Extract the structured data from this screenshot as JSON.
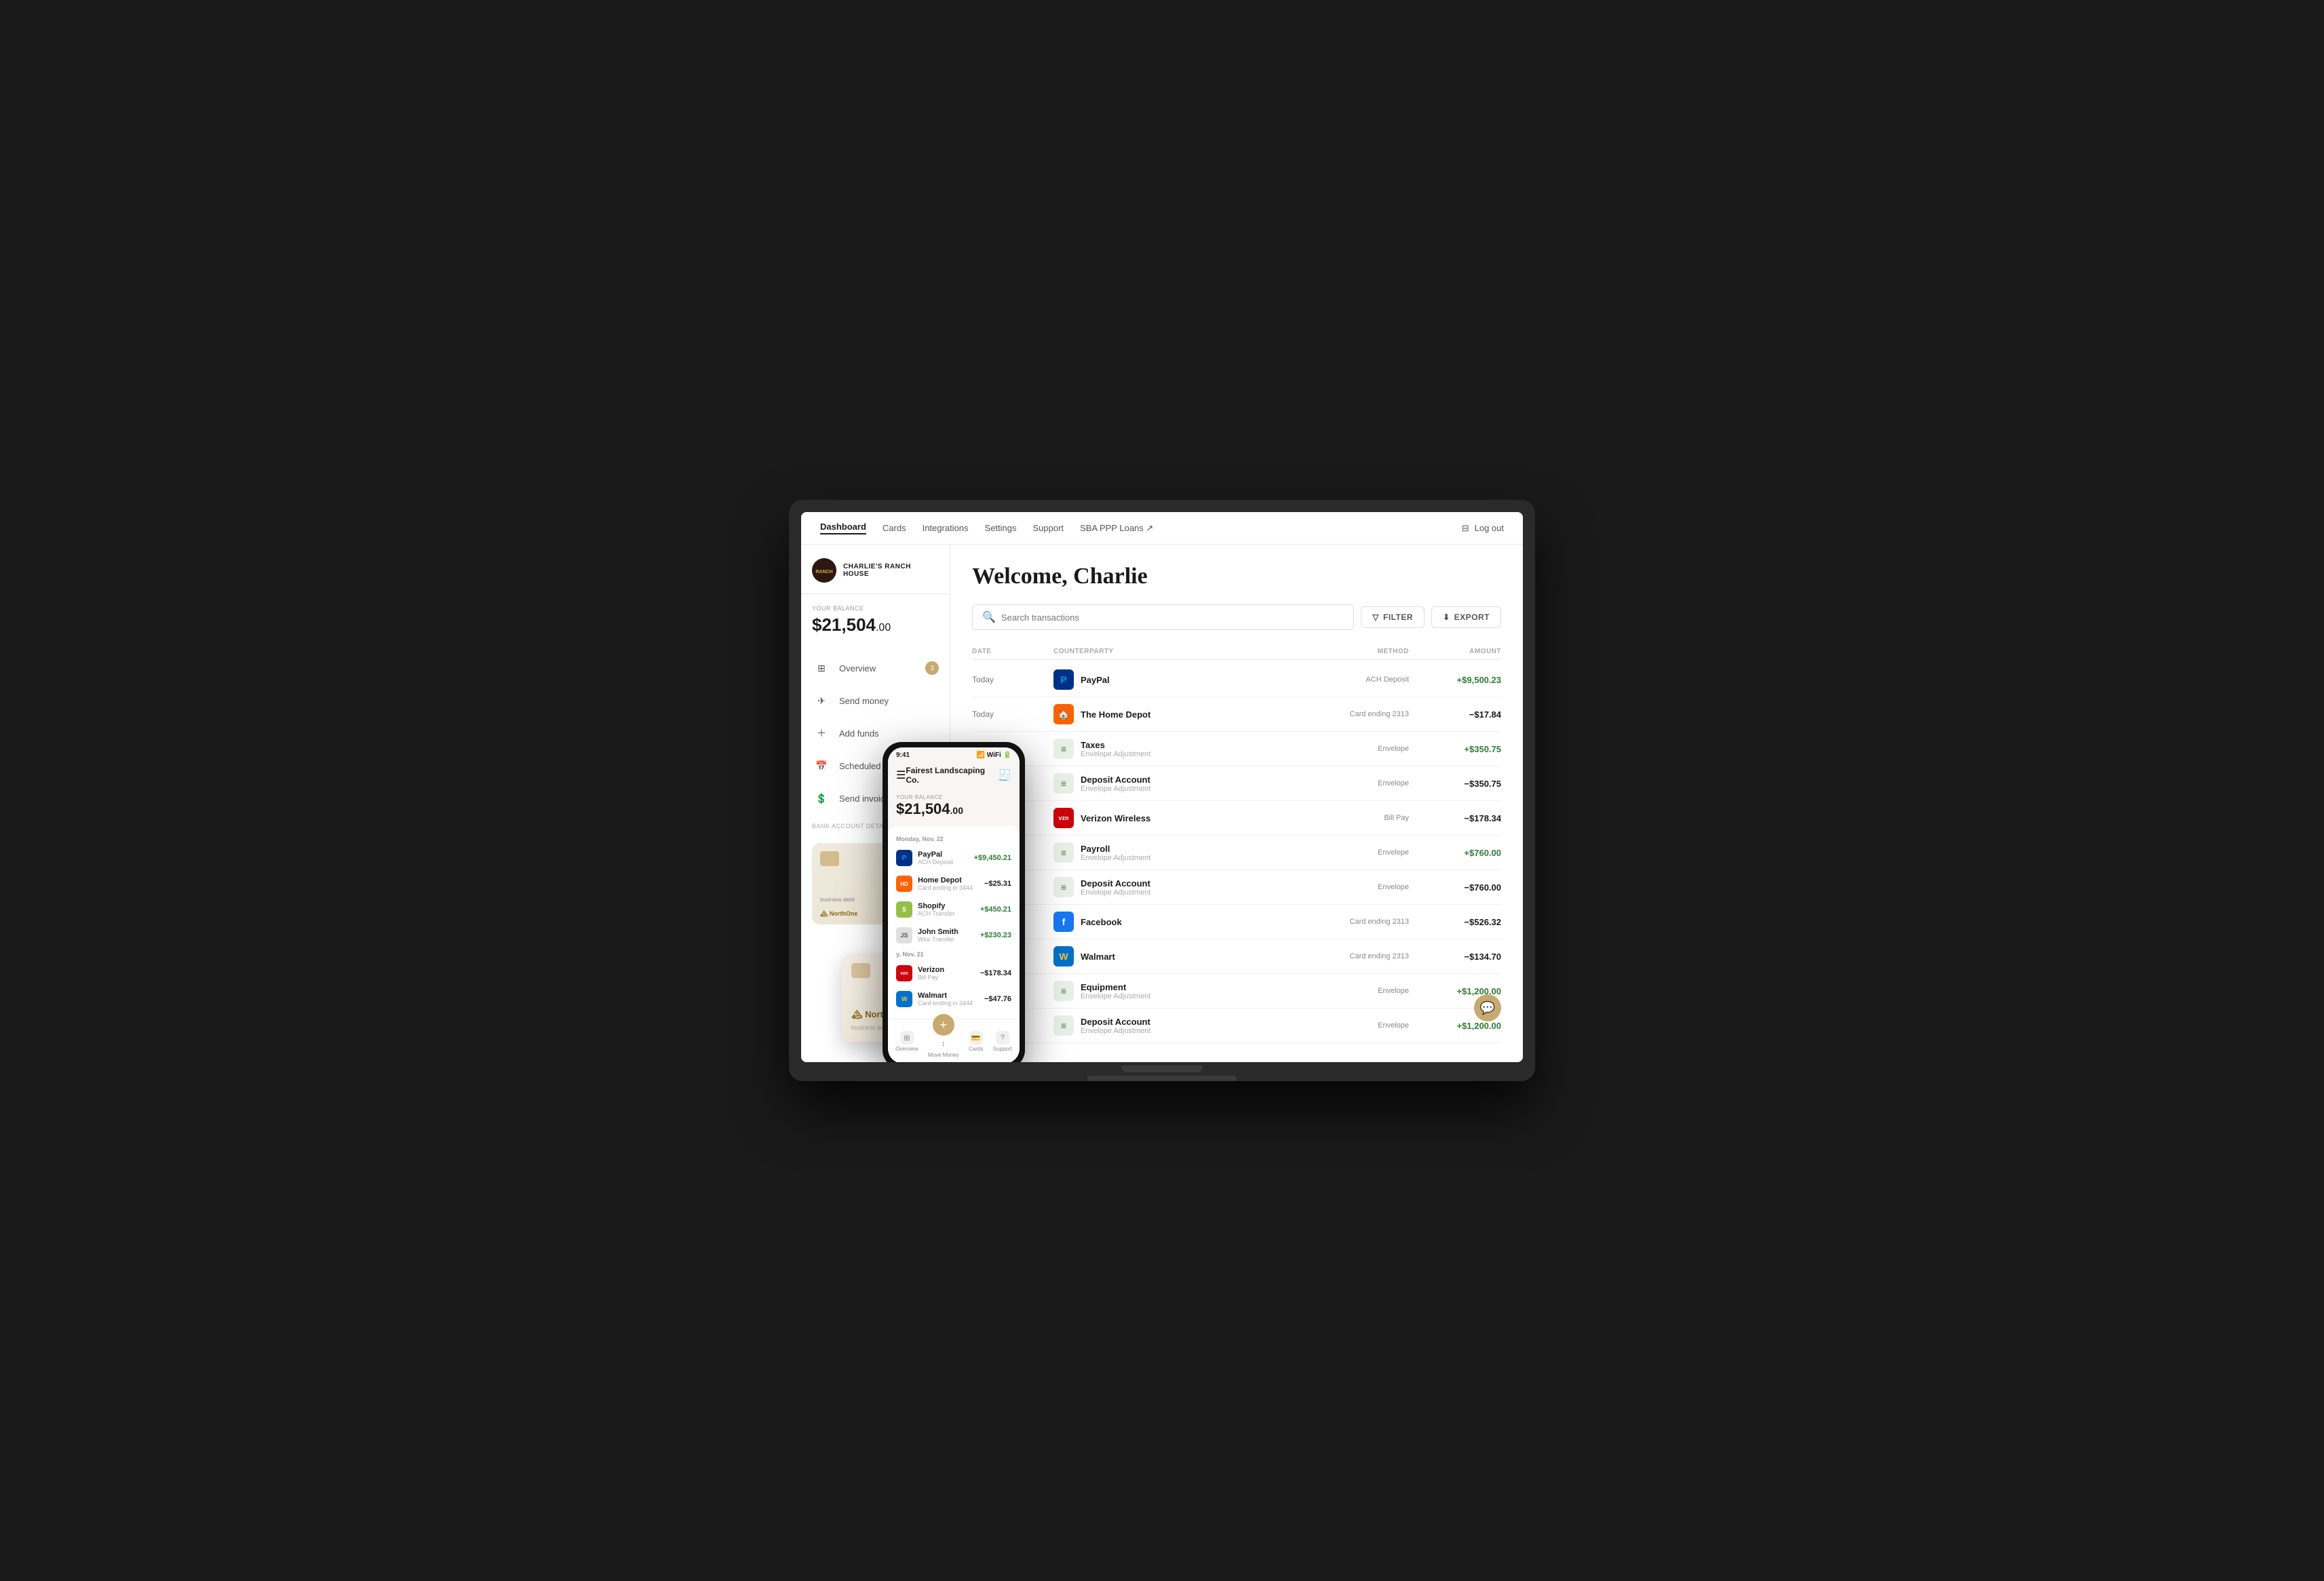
{
  "nav": {
    "links": [
      "Dashboard",
      "Cards",
      "Integrations",
      "Settings",
      "Support",
      "SBA PPP Loans ↗"
    ],
    "active": "Dashboard",
    "logout": "Log out"
  },
  "sidebar": {
    "company": "Charlie's Ranch House",
    "balance_label": "YOUR BALANCE",
    "balance_dollars": "$21,504",
    "balance_cents": ".00",
    "nav_items": [
      {
        "id": "overview",
        "label": "Overview",
        "badge": "3",
        "icon": "⊞"
      },
      {
        "id": "send-money",
        "label": "Send money",
        "icon": "✈"
      },
      {
        "id": "add-funds",
        "label": "Add funds",
        "icon": "+"
      },
      {
        "id": "scheduled-payments",
        "label": "Scheduled payments",
        "icon": "📅"
      },
      {
        "id": "send-invoice",
        "label": "Send invoice",
        "icon": "💲"
      }
    ],
    "bank_account_label": "BANK ACCOUNT DETAILS"
  },
  "content": {
    "welcome": "Welcome, Charlie",
    "search_placeholder": "Search transactions",
    "filter_label": "FILTER",
    "export_label": "EXPORT",
    "table_headers": [
      "DATE",
      "COUNTERPARTY",
      "METHOD",
      "AMOUNT"
    ],
    "transactions": [
      {
        "date": "Today",
        "name": "PayPal",
        "sub": "",
        "method": "ACH Deposit",
        "amount": "+$9,500.23",
        "positive": true,
        "logo_type": "paypal"
      },
      {
        "date": "Today",
        "name": "The Home Depot",
        "sub": "",
        "method": "Card ending 2313",
        "amount": "−$17.84",
        "positive": false,
        "logo_type": "homedepot"
      },
      {
        "date": "",
        "name": "Taxes",
        "sub": "Envelope Adjustment",
        "method": "Envelope",
        "amount": "+$350.75",
        "positive": true,
        "logo_type": "envelope"
      },
      {
        "date": "",
        "name": "Deposit Account",
        "sub": "Envelope Adjustment",
        "method": "Envelope",
        "amount": "−$350.75",
        "positive": false,
        "logo_type": "envelope"
      },
      {
        "date": "",
        "name": "Verizon Wireless",
        "sub": "",
        "method": "Bill Pay",
        "amount": "−$178.34",
        "positive": false,
        "logo_type": "verizon"
      },
      {
        "date": "",
        "name": "Payroll",
        "sub": "Envelope Adjustment",
        "method": "Envelope",
        "amount": "+$760.00",
        "positive": true,
        "logo_type": "envelope"
      },
      {
        "date": "",
        "name": "Deposit Account",
        "sub": "Envelope Adjustment",
        "method": "Envelope",
        "amount": "−$760.00",
        "positive": false,
        "logo_type": "envelope"
      },
      {
        "date": "",
        "name": "Facebook",
        "sub": "",
        "method": "Card ending 2313",
        "amount": "−$526.32",
        "positive": false,
        "logo_type": "facebook"
      },
      {
        "date": "",
        "name": "Walmart",
        "sub": "",
        "method": "Card ending 2313",
        "amount": "−$134.70",
        "positive": false,
        "logo_type": "walmart"
      },
      {
        "date": "",
        "name": "Equipment",
        "sub": "Envelope Adjustment",
        "method": "Envelope",
        "amount": "+$1,200.00",
        "positive": true,
        "logo_type": "envelope"
      },
      {
        "date": "",
        "name": "Deposit Account",
        "sub": "Envelope Adjustment",
        "method": "Envelope",
        "amount": "+$1,200.00",
        "positive": true,
        "logo_type": "envelope"
      }
    ]
  },
  "phone": {
    "time": "9:41",
    "company": "Fairest Landscaping Co.",
    "balance_label": "YOUR BALANCE",
    "balance": "$21,504",
    "balance_cents": ".00",
    "date_label": "Monday, Nov. 22",
    "transactions": [
      {
        "name": "PayPal",
        "sub": "ACH Deposit",
        "amount": "+$9,450.21",
        "pos": true,
        "logo": "paypal"
      },
      {
        "name": "Home Depot",
        "sub": "Card ending in 3444",
        "amount": "−$25.31",
        "pos": false,
        "logo": "homedepot"
      },
      {
        "name": "Shopify",
        "sub": "ACH Transfer",
        "amount": "+$450.21",
        "pos": true,
        "logo": "shopify"
      },
      {
        "name": "John Smith",
        "sub": "Wire Transfer",
        "amount": "+$230.23",
        "pos": true,
        "logo": "person"
      },
      {
        "name": "Verizon",
        "sub": "Bill Pay",
        "amount": "−$178.34",
        "pos": false,
        "logo": "verizon"
      },
      {
        "name": "Walmart",
        "sub": "Card ending in 3444",
        "amount": "−$47.76",
        "pos": false,
        "logo": "walmart"
      }
    ],
    "date_label2": "y, Nov. 21",
    "nav": [
      {
        "label": "Overview",
        "icon": "⊞"
      },
      {
        "label": "Move Money",
        "icon": "↕"
      },
      {
        "label": "Cards",
        "icon": "💳"
      },
      {
        "label": "Support",
        "icon": "?"
      }
    ]
  },
  "card": {
    "brand": "NorthOne",
    "type": "business debit"
  },
  "colors": {
    "accent": "#c8a96e",
    "positive": "#2e7d32",
    "brand_dark": "#1a1a1a"
  }
}
